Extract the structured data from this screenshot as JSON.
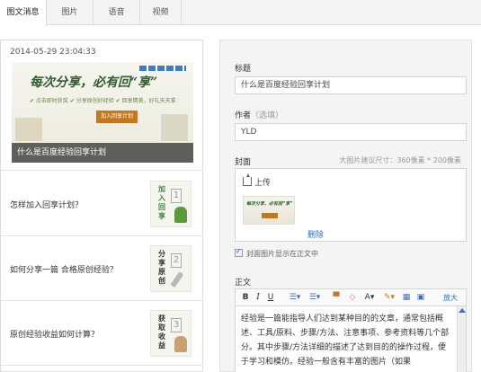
{
  "tabs": [
    {
      "label": "图文消息",
      "active": true
    },
    {
      "label": "图片",
      "active": false
    },
    {
      "label": "语音",
      "active": false
    },
    {
      "label": "视频",
      "active": false
    }
  ],
  "list": {
    "cover": {
      "date": "2014-05-29 23:04:33",
      "banner_main": "每次分享，必有回“享”",
      "banner_sub": "✔ 点击即时获奖   ✔ 分享原创好经验   ✔ 回享精美，好礼天天拿",
      "banner_button": "加入回享计划",
      "title": "什么是百度经验回享计划"
    },
    "items": [
      {
        "title": "怎样加入回享计划？",
        "thumb_text": "加入回享",
        "thumb_num": "1",
        "thumb_color": "#3a8a3a"
      },
      {
        "title": "如何分享一篇 合格原创经验？",
        "thumb_text": "分享原创",
        "thumb_num": "2",
        "thumb_color": "#333333"
      },
      {
        "title": "原创经验收益如何计算？",
        "thumb_text": "获取收益",
        "thumb_num": "3",
        "thumb_color": "#333333"
      }
    ]
  },
  "form": {
    "title_label": "标题",
    "title_value": "什么是百度经验回享计划",
    "author_label": "作者",
    "author_hint": "（选填）",
    "author_value": "YLD",
    "cover_label": "封面",
    "cover_hint": "大图片建议尺寸：360像素 * 200像素",
    "upload_label": "上传",
    "delete_label": "删除",
    "cover_in_body_label": "封面图片显示在正文中",
    "body_label": "正文",
    "toolbar_labels": [
      "B",
      "I",
      "U",
      "☰▾",
      "☰▾",
      "▀",
      "◇",
      "A▾",
      "✎▾",
      "▦",
      "▣",
      "放大"
    ],
    "body_text": "经验是一篇能指导人们达到某种目的的文章，通常包括概述、工具/原料、步骤/方法、注意事项、参考资料等几个部分。其中步骤/方法详细的描述了达到目的的操作过程，便于学习和模仿。经验一般含有丰富的图片（如果"
  }
}
